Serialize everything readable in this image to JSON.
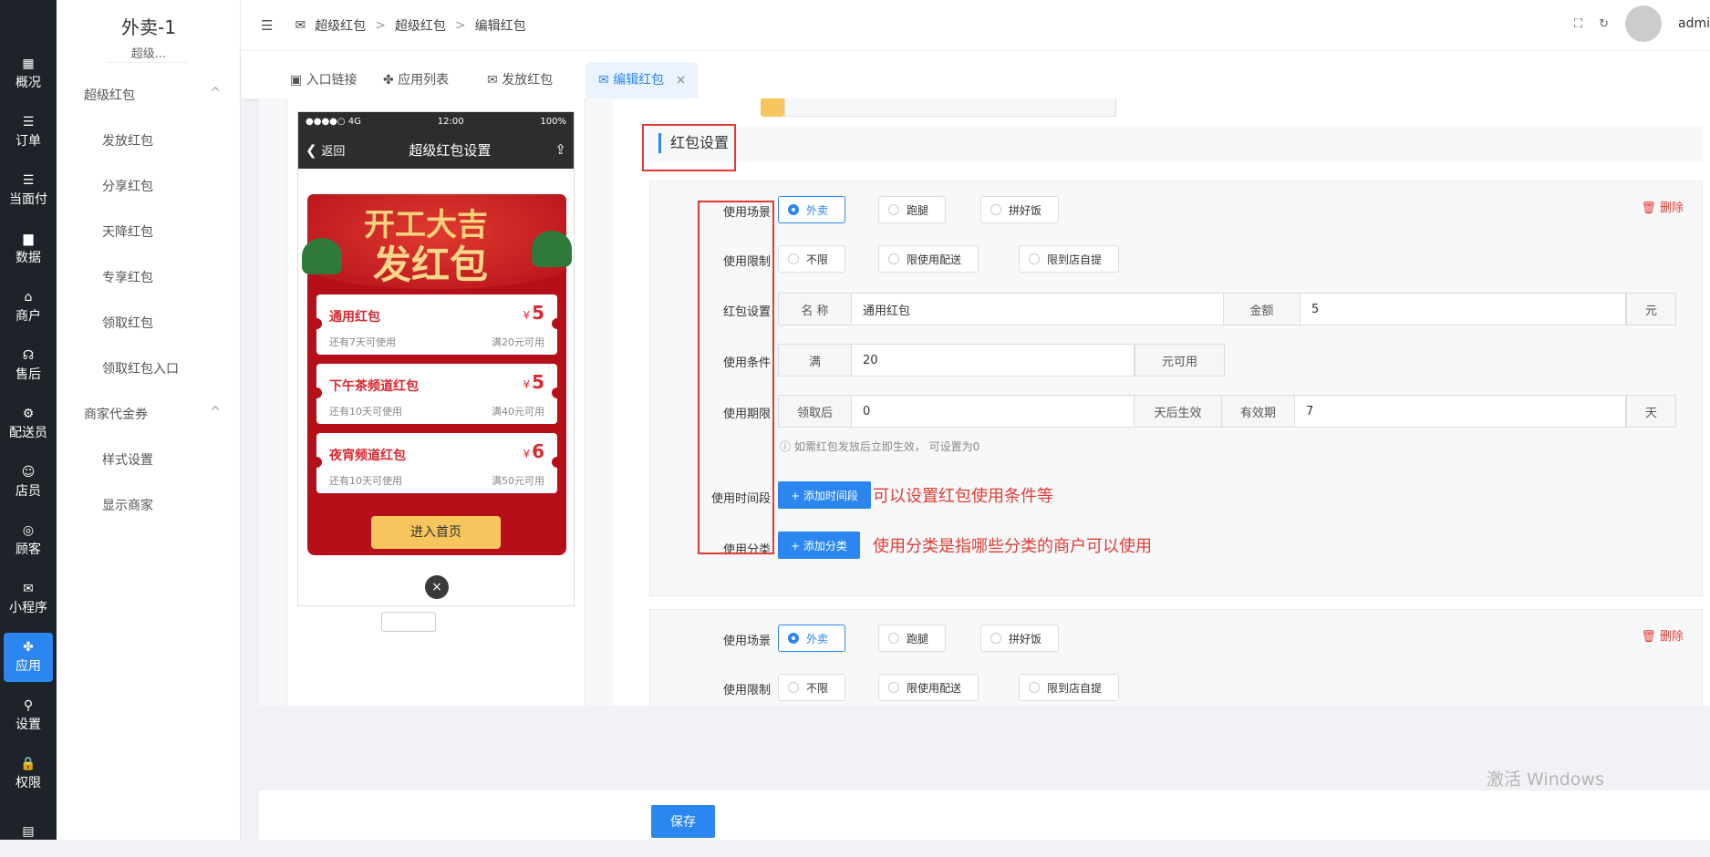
{
  "left_nav": [
    {
      "label": "概况",
      "icon": "dashboard-icon",
      "glyph": "▦"
    },
    {
      "label": "订单",
      "icon": "list-icon",
      "glyph": "☰"
    },
    {
      "label": "当面付",
      "icon": "list-icon",
      "glyph": "☰"
    },
    {
      "label": "数据",
      "icon": "bar-chart-icon",
      "glyph": "▆"
    },
    {
      "label": "商户",
      "icon": "store-icon",
      "glyph": "⌂"
    },
    {
      "label": "售后",
      "icon": "headset-icon",
      "glyph": "☊"
    },
    {
      "label": "配送员",
      "icon": "scooter-icon",
      "glyph": "⚙"
    },
    {
      "label": "店员",
      "icon": "user-icon",
      "glyph": "☺"
    },
    {
      "label": "顾客",
      "icon": "customer-icon",
      "glyph": "◎"
    },
    {
      "label": "小程序",
      "icon": "wechat-icon",
      "glyph": "✉"
    },
    {
      "label": "应用",
      "icon": "apps-icon",
      "glyph": "✤"
    },
    {
      "label": "设置",
      "icon": "settings-user-icon",
      "glyph": "⚲"
    },
    {
      "label": "权限",
      "icon": "lock-icon",
      "glyph": "🔒"
    },
    {
      "label": "",
      "icon": "report-icon",
      "glyph": "▤"
    }
  ],
  "sub_nav": {
    "title": "外卖-1",
    "subtitle": "超级...",
    "groups": [
      {
        "label": "超级红包",
        "items": [
          "发放红包",
          "分享红包",
          "天降红包",
          "专享红包",
          "领取红包",
          "领取红包入口"
        ]
      },
      {
        "label": "商家代金券",
        "items": [
          "样式设置",
          "显示商家"
        ]
      }
    ],
    "chevron": "^"
  },
  "breadcrumb": [
    "超级红包",
    "超级红包",
    "编辑红包"
  ],
  "breadcrumb_sep": ">",
  "user": {
    "name": "admi"
  },
  "tabs": [
    {
      "label": "入口链接",
      "icon": "vip-icon",
      "glyph": "▣"
    },
    {
      "label": "应用列表",
      "icon": "apps-icon",
      "glyph": "✤"
    },
    {
      "label": "发放红包",
      "icon": "envelope-icon",
      "glyph": "✉"
    },
    {
      "label": "编辑红包",
      "icon": "envelope-icon",
      "glyph": "✉",
      "close": "×"
    }
  ],
  "phone": {
    "status_left": "●●●●○ 4G",
    "status_time": "12:00",
    "status_right": "100%",
    "back": "返回",
    "title": "超级红包设置",
    "banner_line1": "开工大吉",
    "banner_line2": "发红包",
    "coupons": [
      {
        "name": "通用红包",
        "amount": "5",
        "desc": "还有7天可使用",
        "cond": "满20元可用"
      },
      {
        "name": "下午茶频道红包",
        "amount": "5",
        "desc": "还有10天可使用",
        "cond": "满40元可用"
      },
      {
        "name": "夜宵频道红包",
        "amount": "6",
        "desc": "还有10天可使用",
        "cond": "满50元可用"
      }
    ],
    "currency": "¥",
    "enter_button": "进入首页",
    "close": "×"
  },
  "section_title": "红包设置",
  "form1": {
    "scene_label": "使用场景",
    "scene_options": [
      "外卖",
      "跑腿",
      "拼好饭"
    ],
    "limit_label": "使用限制",
    "limit_options": [
      "不限",
      "限使用配送",
      "限到店自提"
    ],
    "setting_label": "红包设置",
    "name_addon": "名 称",
    "name_value": "通用红包",
    "amount_addon": "金额",
    "amount_value": "5",
    "amount_unit": "元",
    "cond_label": "使用条件",
    "cond_prefix": "满",
    "cond_value": "20",
    "cond_suffix": "元可用",
    "period_label": "使用期限",
    "period_prefix": "领取后",
    "period_value": "0",
    "period_mid": "天后生效",
    "valid_addon": "有效期",
    "valid_value": "7",
    "valid_unit": "天",
    "period_hint": "如需红包发放后立即生效， 可设置为0",
    "time_label": "使用时间段",
    "time_button": "+ 添加时间段",
    "cat_label": "使用分类",
    "cat_button": "+ 添加分类",
    "delete": "删除"
  },
  "notes": [
    "可以设置红包使用条件等",
    "使用分类是指哪些分类的商户可以使用"
  ],
  "form2": {
    "scene_label": "使用场景",
    "scene_options": [
      "外卖",
      "跑腿",
      "拼好饭"
    ],
    "limit_label": "使用限制",
    "limit_options": [
      "不限",
      "限使用配送",
      "限到店自提"
    ],
    "delete": "删除"
  },
  "save_button": "保存",
  "watermark": "激活 Windows",
  "colors": {
    "accent": "#2b86f0",
    "danger": "#e03c32",
    "sidebar": "#1e2329",
    "coupon_red": "#b5101a"
  }
}
